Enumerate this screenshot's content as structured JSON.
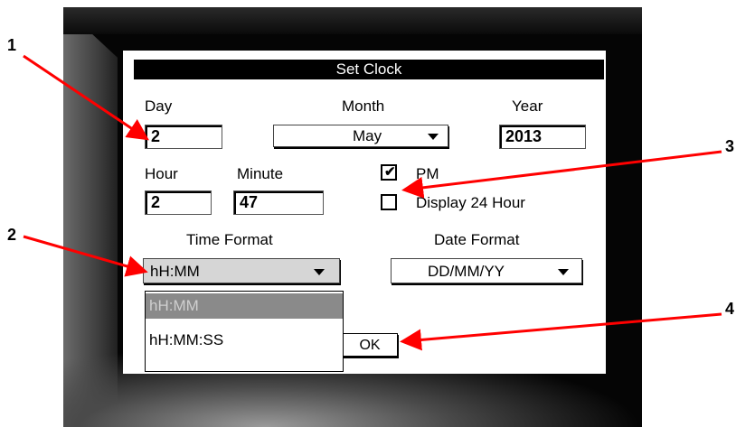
{
  "dialog": {
    "title": "Set Clock",
    "day_label": "Day",
    "day_value": "2",
    "month_label": "Month",
    "month_value": "May",
    "year_label": "Year",
    "year_value": "2013",
    "hour_label": "Hour",
    "hour_value": "2",
    "minute_label": "Minute",
    "minute_value": "47",
    "pm_label": "PM",
    "pm_checked": true,
    "display24_label": "Display 24 Hour",
    "display24_checked": false,
    "time_format_label": "Time Format",
    "time_format_value": "hH:MM",
    "date_format_label": "Date Format",
    "date_format_value": "DD/MM/YY",
    "time_format_options": [
      "hH:MM",
      "hH:MM:SS"
    ],
    "ok_label": "OK"
  },
  "callouts": [
    "1",
    "2",
    "3",
    "4"
  ],
  "colors": {
    "arrow": "#ff0000",
    "highlight": "#8a8a8a",
    "title_bar": "#000000"
  }
}
